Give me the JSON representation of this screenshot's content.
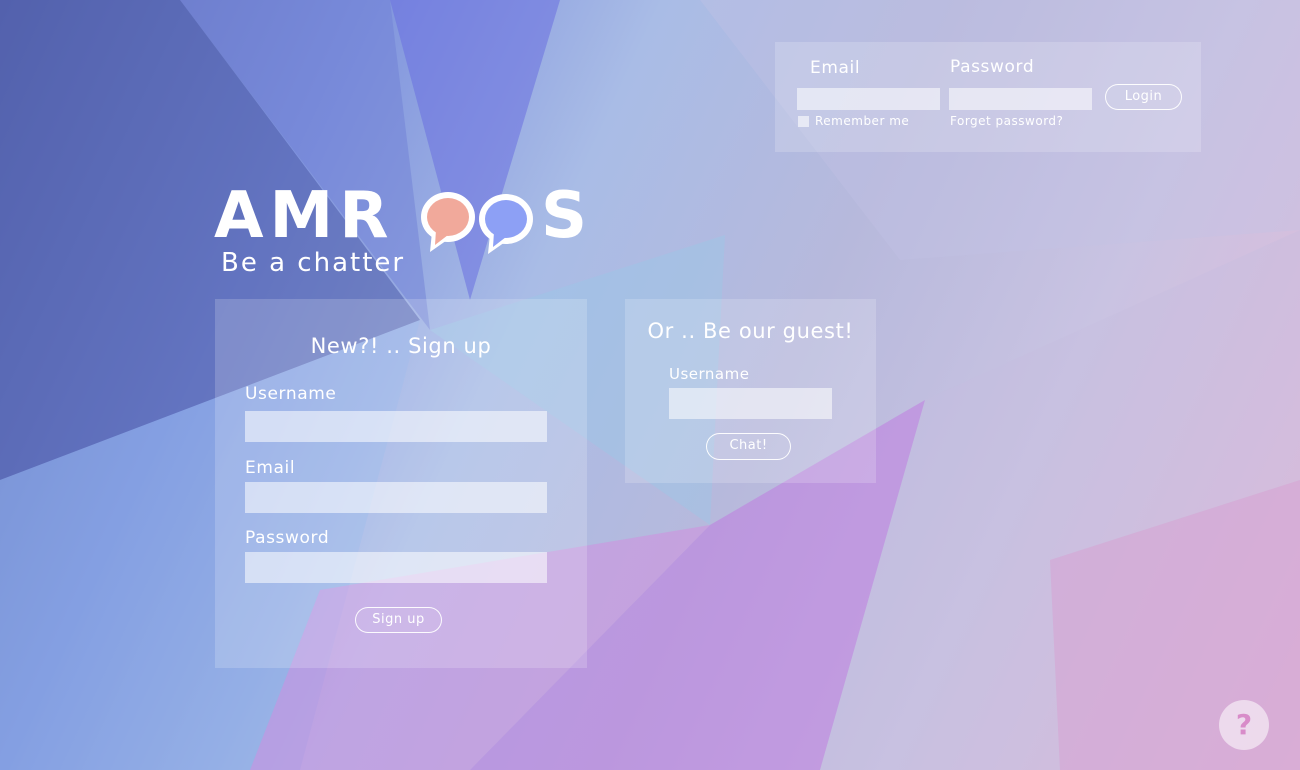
{
  "login_bar": {
    "email_label": "Email",
    "password_label": "Password",
    "login_button": "Login",
    "remember_me": "Remember me",
    "forget_password": "Forget password?"
  },
  "brand": {
    "name_part1": "AMR",
    "name_part2": "S",
    "tagline": "Be a chatter"
  },
  "signup": {
    "title": "New?! .. Sign up",
    "username_label": "Username",
    "email_label": "Email",
    "password_label": "Password",
    "submit": "Sign up"
  },
  "guest": {
    "title": "Or .. Be our guest!",
    "username_label": "Username",
    "submit": "Chat!"
  },
  "help": {
    "label": "?"
  },
  "colors": {
    "bubble_left": "#f1a99b",
    "bubble_right": "#8da0f5",
    "help_glyph": "#d88cc9"
  }
}
